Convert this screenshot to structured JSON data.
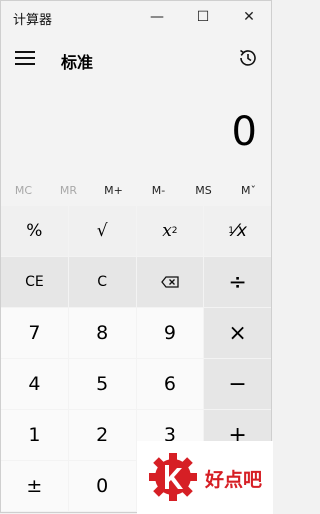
{
  "window": {
    "title": "计算器",
    "minimize_label": "—",
    "maximize_label": "☐",
    "close_label": "✕"
  },
  "header": {
    "mode_title": "标准"
  },
  "display": {
    "value": "0"
  },
  "memory": [
    {
      "label": "MC",
      "state": "disabled"
    },
    {
      "label": "MR",
      "state": "disabled"
    },
    {
      "label": "M+",
      "state": "enabled"
    },
    {
      "label": "M-",
      "state": "enabled"
    },
    {
      "label": "MS",
      "state": "enabled"
    },
    {
      "label": "Mˇ",
      "state": "enabled"
    }
  ],
  "keys": {
    "percent": "%",
    "sqrt": "√",
    "square_base": "x",
    "square_exp": "2",
    "reciprocal_num": "1",
    "reciprocal_den": "⁄x",
    "ce": "CE",
    "c": "C",
    "backspace": "⌫",
    "divide": "÷",
    "seven": "7",
    "eight": "8",
    "nine": "9",
    "multiply": "×",
    "four": "4",
    "five": "5",
    "six": "6",
    "minus": "−",
    "one": "1",
    "two": "2",
    "three": "3",
    "plus": "+",
    "negate": "±",
    "zero": "0"
  },
  "watermark": {
    "text": "好点吧"
  },
  "colors": {
    "background": "#f3f3f3",
    "number_key": "#fafafa",
    "operator_key": "#e6e6e6",
    "memory_disabled": "#a8a8a8",
    "watermark_red": "#d61f25"
  },
  "icons": {
    "menu": "hamburger-icon",
    "history": "history-icon",
    "backspace": "backspace-icon"
  }
}
